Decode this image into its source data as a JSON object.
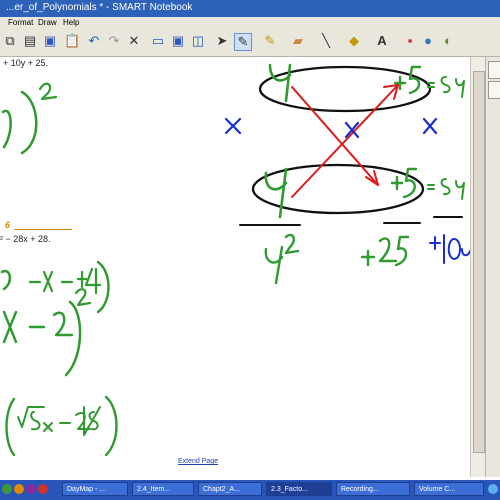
{
  "window": {
    "title": "...er_of_Polynomials *  - SMART Notebook"
  },
  "menu": [
    "Format",
    "Draw",
    "Help"
  ],
  "toolbar": {
    "icons": [
      "copy-icon",
      "document-icon",
      "save-icon",
      "paste-icon",
      "undo-icon",
      "redo-icon",
      "delete-icon",
      "screen-shade-icon",
      "full-screen-icon",
      "dual-page-icon",
      "select-icon",
      "pen-icon",
      "highlighter-icon",
      "eraser-icon",
      "line-icon",
      "fill-icon",
      "text-icon",
      "properties-icon",
      "globe-icon",
      "more-icon"
    ]
  },
  "page": {
    "typed_text_1": "+ 10y + 25.",
    "problem_number": "6",
    "typed_text_2": "² − 28x + 28.",
    "extend_label": "Extend Page"
  },
  "handwriting": {
    "left_column": [
      "5)²",
      "-4x+4)",
      "x-2)²",
      "(√5x - 2√5)"
    ],
    "box_top": [
      "y",
      "+5",
      "=5y"
    ],
    "box_bottom": [
      "y",
      "+5",
      "=5y"
    ],
    "cross_marks": [
      "x",
      "x",
      "x"
    ],
    "under_left": "y²",
    "under_middle": "+25",
    "under_right": "+10y"
  },
  "colors": {
    "ink_green": "#2f9a2f",
    "ink_black": "#111111",
    "ink_red": "#e01818",
    "ink_blue": "#1a2fd0",
    "accent_orange": "#e08a00"
  },
  "taskbar": {
    "items": [
      "DayMap - ...",
      "2.4_Item...",
      "Chapt2_A...",
      "2.3_Facto...",
      "Recording...",
      "Volume C..."
    ]
  }
}
